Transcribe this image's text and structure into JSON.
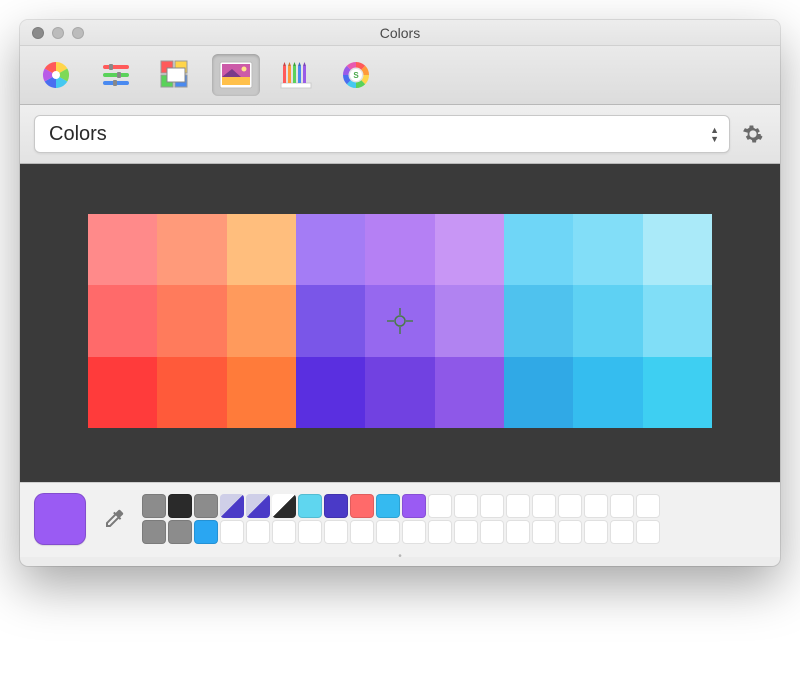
{
  "window": {
    "title": "Colors"
  },
  "toolbar": {
    "tabs": [
      {
        "name": "color-wheel"
      },
      {
        "name": "color-sliders"
      },
      {
        "name": "color-palettes"
      },
      {
        "name": "image-palettes",
        "selected": true
      },
      {
        "name": "pencils"
      },
      {
        "name": "spectrum"
      }
    ]
  },
  "palette_select": {
    "value": "Colors"
  },
  "image_grid": {
    "rows": [
      [
        "#ff8a8a",
        "#ff9a7a",
        "#ffbe7d",
        "#a47cf5",
        "#b580f4",
        "#c896f5",
        "#6fd6f7",
        "#82def8",
        "#aaeaf9"
      ],
      [
        "#ff6a6a",
        "#ff7b5c",
        "#ff9a5c",
        "#7a56e8",
        "#9668ef",
        "#b183f1",
        "#4fc2ee",
        "#5ed1f3",
        "#80def7"
      ],
      [
        "#ff3b3b",
        "#ff5a3a",
        "#ff7b3a",
        "#5a2fe0",
        "#7141e1",
        "#8e58e8",
        "#30a9e6",
        "#35bdef",
        "#3ecff2"
      ]
    ]
  },
  "selected_color": "#9a5bf3",
  "swatches": {
    "row1": [
      {
        "c": "#8c8c8c"
      },
      {
        "c": "#2a2a2a"
      },
      {
        "c": "#8c8c8c"
      },
      {
        "diag": true,
        "c1": "#cfcfe8",
        "c2": "#4a3ac7"
      },
      {
        "diag": true,
        "c1": "#cfcfe8",
        "c2": "#4a3ac7"
      },
      {
        "diag": true,
        "c1": "#ffffff",
        "c2": "#2a2a2a"
      },
      {
        "c": "#5fd6ef"
      },
      {
        "c": "#4a3ac7"
      },
      {
        "c": "#ff6a6a"
      },
      {
        "c": "#35baf0"
      },
      {
        "c": "#9a5bf3"
      },
      {
        "c": null
      },
      {
        "c": null
      },
      {
        "c": null
      },
      {
        "c": null
      },
      {
        "c": null
      },
      {
        "c": null
      },
      {
        "c": null
      },
      {
        "c": null
      },
      {
        "c": null
      }
    ],
    "row2": [
      {
        "c": "#8c8c8c"
      },
      {
        "c": "#8c8c8c"
      },
      {
        "c": "#2aa6f2"
      },
      {
        "c": null
      },
      {
        "c": null
      },
      {
        "c": null
      },
      {
        "c": null
      },
      {
        "c": null
      },
      {
        "c": null
      },
      {
        "c": null
      },
      {
        "c": null
      },
      {
        "c": null
      },
      {
        "c": null
      },
      {
        "c": null
      },
      {
        "c": null
      },
      {
        "c": null
      },
      {
        "c": null
      },
      {
        "c": null
      },
      {
        "c": null
      },
      {
        "c": null
      }
    ]
  }
}
